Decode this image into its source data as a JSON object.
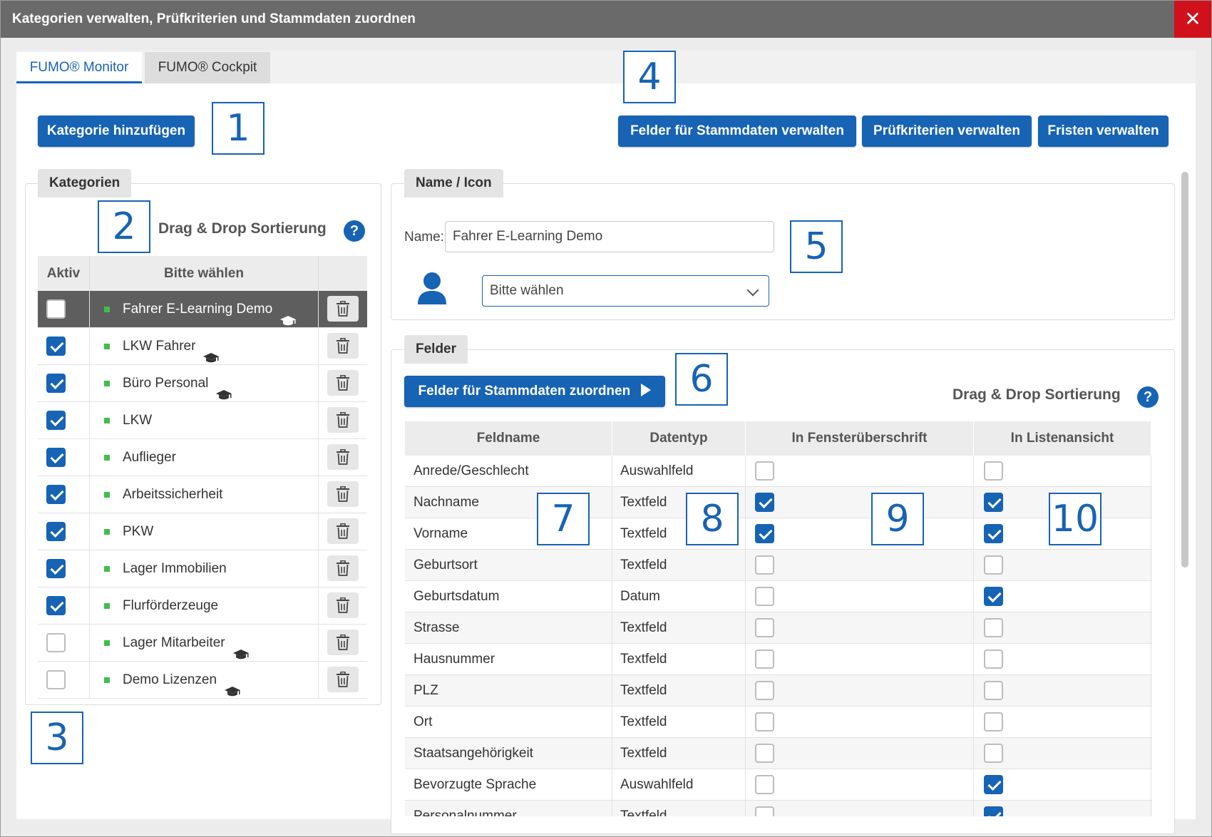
{
  "window": {
    "title": "Kategorien verwalten, Prüfkriterien und Stammdaten zuordnen",
    "close_symbol": "✕"
  },
  "tabs": [
    {
      "label": "FUMO® Monitor",
      "active": true
    },
    {
      "label": "FUMO® Cockpit",
      "active": false
    }
  ],
  "toolbar": {
    "add_category": "Kategorie hinzufügen",
    "manage_master_fields": "Felder für Stammdaten verwalten",
    "manage_criteria": "Prüfkriterien verwalten",
    "manage_deadlines": "Fristen verwalten"
  },
  "callouts": [
    "1",
    "2",
    "3",
    "4",
    "5",
    "6",
    "7",
    "8",
    "9",
    "10"
  ],
  "categories_panel": {
    "legend": "Kategorien",
    "dnd_label": "Drag & Drop Sortierung",
    "help_symbol": "?",
    "headers": {
      "active": "Aktiv",
      "name": "Bitte wählen"
    },
    "rows": [
      {
        "name": "Fahrer E-Learning Demo",
        "active": false,
        "elearning": true,
        "selected": true
      },
      {
        "name": "LKW Fahrer",
        "active": true,
        "elearning": true
      },
      {
        "name": "Büro Personal",
        "active": true,
        "elearning": true
      },
      {
        "name": "LKW",
        "active": true,
        "elearning": false
      },
      {
        "name": "Auflieger",
        "active": true,
        "elearning": false
      },
      {
        "name": "Arbeitssicherheit",
        "active": true,
        "elearning": false
      },
      {
        "name": "PKW",
        "active": true,
        "elearning": false
      },
      {
        "name": "Lager Immobilien",
        "active": true,
        "elearning": false
      },
      {
        "name": "Flurförderzeuge",
        "active": true,
        "elearning": false
      },
      {
        "name": "Lager Mitarbeiter",
        "active": false,
        "elearning": true
      },
      {
        "name": "Demo Lizenzen",
        "active": false,
        "elearning": true
      }
    ]
  },
  "name_icon_panel": {
    "legend": "Name / Icon",
    "name_label": "Name:",
    "name_value": "Fahrer E-Learning Demo",
    "icon_select_value": "Bitte wählen"
  },
  "fields_panel": {
    "legend": "Felder",
    "assign_button": "Felder für Stammdaten zuordnen",
    "dnd_label": "Drag & Drop Sortierung",
    "help_symbol": "?",
    "headers": {
      "name": "Feldname",
      "type": "Datentyp",
      "in_title": "In Fensterüberschrift",
      "in_list": "In Listenansicht"
    },
    "rows": [
      {
        "name": "Anrede/Geschlecht",
        "type": "Auswahlfeld",
        "in_title": false,
        "in_list": false
      },
      {
        "name": "Nachname",
        "type": "Textfeld",
        "in_title": true,
        "in_list": true
      },
      {
        "name": "Vorname",
        "type": "Textfeld",
        "in_title": true,
        "in_list": true
      },
      {
        "name": "Geburtsort",
        "type": "Textfeld",
        "in_title": false,
        "in_list": false
      },
      {
        "name": "Geburtsdatum",
        "type": "Datum",
        "in_title": false,
        "in_list": true
      },
      {
        "name": "Strasse",
        "type": "Textfeld",
        "in_title": false,
        "in_list": false
      },
      {
        "name": "Hausnummer",
        "type": "Textfeld",
        "in_title": false,
        "in_list": false
      },
      {
        "name": "PLZ",
        "type": "Textfeld",
        "in_title": false,
        "in_list": false
      },
      {
        "name": "Ort",
        "type": "Textfeld",
        "in_title": false,
        "in_list": false
      },
      {
        "name": "Staatsangehörigkeit",
        "type": "Textfeld",
        "in_title": false,
        "in_list": false
      },
      {
        "name": "Bevorzugte Sprache",
        "type": "Auswahlfeld",
        "in_title": false,
        "in_list": true
      },
      {
        "name": "Personalnummer",
        "type": "Textfeld",
        "in_title": false,
        "in_list": true
      }
    ]
  },
  "colors": {
    "primary": "#1763b4",
    "titlebar": "#6a6a6a",
    "close": "#d0111b",
    "status_green": "#3fbf4a",
    "selected_row": "#5e5e5e"
  }
}
